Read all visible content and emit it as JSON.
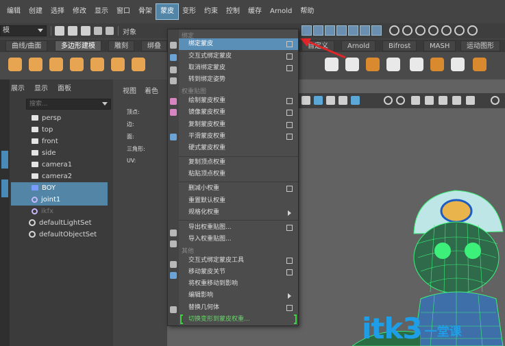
{
  "menubar": {
    "items": [
      "编辑",
      "创建",
      "选择",
      "修改",
      "显示",
      "窗口",
      "骨架",
      "蒙皮",
      "变形",
      "约束",
      "控制",
      "缓存",
      "Arnold",
      "帮助"
    ],
    "active_index": 7
  },
  "toolbar": {
    "mode_value": "模",
    "object_label": "对象"
  },
  "shelf": {
    "tabs": [
      "曲线/曲面",
      "多边形建模",
      "雕刻",
      "绑叠",
      "自定义",
      "Arnold",
      "Bifrost",
      "MASH",
      "运动图形"
    ],
    "active_index": 1
  },
  "outliner": {
    "menu": [
      "展示",
      "显示",
      "面板"
    ],
    "search_placeholder": "搜索...",
    "rows": [
      {
        "label": "persp",
        "icon": "camera-icon",
        "selected": false
      },
      {
        "label": "top",
        "icon": "camera-icon",
        "selected": false
      },
      {
        "label": "front",
        "icon": "camera-icon",
        "selected": false
      },
      {
        "label": "side",
        "icon": "camera-icon",
        "selected": false
      },
      {
        "label": "camera1",
        "icon": "camera-icon",
        "selected": false
      },
      {
        "label": "camera2",
        "icon": "camera-icon",
        "selected": false
      },
      {
        "label": "BOY",
        "icon": "mesh-icon",
        "selected": true
      },
      {
        "label": "joint1",
        "icon": "joint-icon",
        "selected": true
      },
      {
        "label": "ikfx",
        "icon": "joint-icon",
        "selected": false
      },
      {
        "label": "defaultLightSet",
        "icon": "set-icon",
        "selected": false
      },
      {
        "label": "defaultObjectSet",
        "icon": "set-icon",
        "selected": false
      }
    ]
  },
  "viewport_panel": {
    "menu": [
      "视图",
      "着色"
    ],
    "hud": [
      "顶点:",
      "边:",
      "面:",
      "三角形:",
      "UV:"
    ]
  },
  "dropdown": {
    "sections": [
      "绑定",
      "权重贴图",
      "其他"
    ],
    "items": [
      {
        "label": "绑定蒙皮",
        "option": true,
        "highlight": true,
        "section": 0
      },
      {
        "label": "交互式绑定蒙皮",
        "option": true,
        "section": 0
      },
      {
        "label": "取消绑定蒙皮",
        "option": true,
        "section": 0
      },
      {
        "label": "转到绑定姿势",
        "option": false,
        "section": 0
      },
      {
        "label": "绘制蒙皮权重",
        "option": true,
        "section": 1
      },
      {
        "label": "镜像蒙皮权重",
        "option": true,
        "section": 1
      },
      {
        "label": "复制蒙皮权重",
        "option": true,
        "section": 1
      },
      {
        "label": "平滑蒙皮权重",
        "option": true,
        "section": 1
      },
      {
        "label": "硬式蒙皮权重",
        "option": false,
        "section": 1
      },
      {
        "label": "复制顶点权重",
        "option": false,
        "section": 1
      },
      {
        "label": "粘贴顶点权重",
        "option": false,
        "section": 1
      },
      {
        "label": "删减小权重",
        "option": true,
        "section": 1
      },
      {
        "label": "重置默认权重",
        "option": false,
        "section": 1
      },
      {
        "label": "规格化权重",
        "submenu": true,
        "section": 1
      },
      {
        "label": "导出权重贴图...",
        "option": true,
        "section": 1
      },
      {
        "label": "导入权重贴图...",
        "option": false,
        "section": 1
      },
      {
        "label": "交互式绑定蒙皮工具",
        "option": true,
        "section": 2
      },
      {
        "label": "移动蒙皮关节",
        "option": true,
        "section": 2
      },
      {
        "label": "将权重移动到影响",
        "option": false,
        "section": 2
      },
      {
        "label": "编辑影响",
        "submenu": true,
        "section": 2
      },
      {
        "label": "替换几何体",
        "option": true,
        "section": 2
      },
      {
        "label": "切换变形到蒙皮权重...",
        "green": true,
        "section": 2
      }
    ]
  },
  "watermark": {
    "text": "itk3",
    "sub": "一堂课"
  },
  "colors": {
    "highlight": "#5a8fb8",
    "selection": "#5285a6",
    "wireframe": "#3cf07a",
    "watermark": "#1e9ee6"
  }
}
